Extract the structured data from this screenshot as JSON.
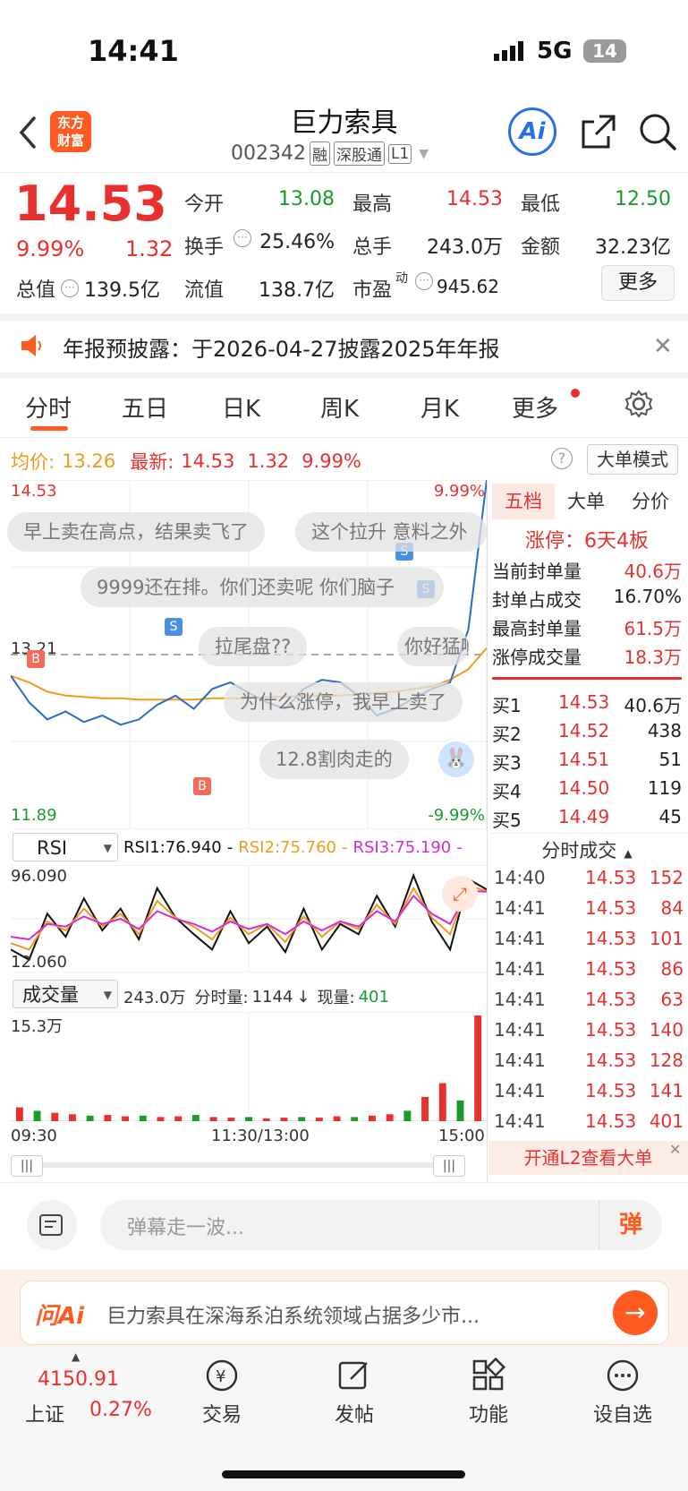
{
  "status_bar": {
    "time": "14:41",
    "network": "5G",
    "battery": "14"
  },
  "header": {
    "title": "巨力索具",
    "code": "002342",
    "tags": [
      "融",
      "深股通",
      "L1"
    ],
    "logo_line1": "东方",
    "logo_line2": "财富",
    "ai_label": "Ai"
  },
  "quote": {
    "price": "14.53",
    "change_pct": "9.99%",
    "change_amt": "1.32",
    "total_mv_label": "总值",
    "total_mv": "139.5亿",
    "fields": [
      {
        "label": "今开",
        "value": "13.08",
        "color": "#1a9c2c"
      },
      {
        "label": "最高",
        "value": "14.53",
        "color": "#e8312f"
      },
      {
        "label": "最低",
        "value": "12.50",
        "color": "#1a9c2c"
      },
      {
        "label": "换手",
        "value": "25.46%",
        "color": "#222222"
      },
      {
        "label": "总手",
        "value": "243.0万",
        "color": "#222222"
      },
      {
        "label": "金额",
        "value": "32.23亿",
        "color": "#222222"
      },
      {
        "label": "流值",
        "value": "138.7亿",
        "color": "#222222"
      },
      {
        "label": "市盈",
        "value": "945.62",
        "color": "#222222",
        "sup": "动"
      }
    ],
    "more_button": "更多"
  },
  "announcement": {
    "text": "年报预披露：于2026-04-27披露2025年年报"
  },
  "tabs": [
    "分时",
    "五日",
    "日K",
    "周K",
    "月K",
    "更多"
  ],
  "active_tab": "分时",
  "chart_header": {
    "avg_label": "均价:",
    "avg_value": "13.26",
    "latest_label": "最新:",
    "latest_value": "14.53",
    "change_amt": "1.32",
    "change_pct": "9.99%",
    "big_order_button": "大单模式"
  },
  "chart_labels": {
    "price_high": "14.53",
    "pct_high": "9.99%",
    "prev_close": "13.21",
    "price_low": "11.89",
    "pct_low": "-9.99%",
    "time_start": "09:30",
    "time_mid": "11:30/13:00",
    "time_end": "15:00",
    "trade_markers": [
      "B",
      "S",
      "B",
      "S",
      "S"
    ]
  },
  "chart_data": [
    {
      "type": "line",
      "title": "分时",
      "x_labels": [
        "09:30",
        "11:30/13:00",
        "15:00"
      ],
      "ylim": [
        11.89,
        14.53
      ],
      "reference_line": 13.21,
      "series": [
        {
          "name": "均价",
          "color": "#f09a1c",
          "values": [
            13.05,
            13.0,
            12.93,
            12.9,
            12.89,
            12.88,
            12.88,
            12.87,
            12.87,
            12.87,
            12.87,
            12.88,
            12.88,
            12.88,
            12.89,
            12.89,
            12.9,
            12.9,
            12.9,
            12.91,
            12.92,
            12.93,
            12.95,
            12.97,
            13.02,
            13.1,
            13.26
          ]
        },
        {
          "name": "最新",
          "color": "#2b6cc4",
          "values": [
            13.05,
            12.85,
            12.72,
            12.78,
            12.7,
            12.75,
            12.68,
            12.72,
            12.83,
            12.9,
            12.8,
            12.95,
            13.0,
            12.92,
            12.85,
            12.8,
            12.95,
            13.02,
            13.0,
            12.9,
            12.75,
            12.8,
            12.88,
            12.95,
            13.0,
            13.4,
            14.53
          ]
        }
      ]
    },
    {
      "type": "line",
      "title": "RSI",
      "ylim": [
        12.06,
        96.09
      ],
      "series": [
        {
          "name": "RSI1",
          "color": "#111111",
          "values": [
            30,
            22,
            58,
            40,
            70,
            45,
            62,
            38,
            78,
            55,
            42,
            30,
            60,
            35,
            48,
            28,
            62,
            30,
            50,
            42,
            72,
            48,
            88,
            52,
            30,
            85,
            76.94
          ]
        },
        {
          "name": "RSI2",
          "color": "#f09a1c",
          "values": [
            35,
            30,
            52,
            45,
            62,
            48,
            58,
            42,
            68,
            55,
            48,
            38,
            55,
            42,
            50,
            36,
            56,
            40,
            52,
            46,
            65,
            50,
            78,
            55,
            42,
            80,
            75.76
          ]
        },
        {
          "name": "RSI3",
          "color": "#d62ad6",
          "values": [
            40,
            38,
            50,
            48,
            56,
            50,
            54,
            46,
            60,
            54,
            50,
            44,
            52,
            46,
            50,
            42,
            52,
            45,
            52,
            48,
            60,
            52,
            72,
            58,
            50,
            76,
            75.19
          ]
        }
      ]
    },
    {
      "type": "bar",
      "title": "成交量",
      "ylim": [
        0,
        15.3
      ],
      "values": [
        2.0,
        1.5,
        1.2,
        1.0,
        0.8,
        0.9,
        0.7,
        0.8,
        0.6,
        0.7,
        0.9,
        0.6,
        0.5,
        0.6,
        0.4,
        0.5,
        0.6,
        0.5,
        0.7,
        0.6,
        0.8,
        1.0,
        1.5,
        3.5,
        5.5,
        3.0,
        15.3
      ]
    }
  ],
  "rsi": {
    "selector": "RSI",
    "rsi1": "RSI1:76.940",
    "rsi2": "RSI2:75.760",
    "rsi3": "RSI3:75.190",
    "max": "96.090",
    "min": "12.060"
  },
  "volume": {
    "selector": "成交量",
    "total": "243.0万",
    "period_label": "分时量:",
    "period_value": "1144",
    "now_label": "现量:",
    "now_value": "401",
    "max": "15.3万"
  },
  "danmaku": [
    "早上卖在高点，结果卖飞了",
    "这个拉升 意料之外",
    "9999还在排。你们还卖呢 你们脑子",
    "拉尾盘??",
    "你好猛啊",
    "为什么涨停，我早上卖了",
    "12.8割肉走的"
  ],
  "side_tabs": [
    "五档",
    "大单",
    "分价"
  ],
  "side_active": "五档",
  "limit_info": {
    "title": "涨停：6天4板",
    "rows": [
      {
        "label": "当前封单量",
        "value": "40.6万"
      },
      {
        "label": "封单占成交",
        "value": "16.70%"
      },
      {
        "label": "最高封单量",
        "value": "61.5万"
      },
      {
        "label": "涨停成交量",
        "value": "18.3万"
      }
    ]
  },
  "order_book": [
    {
      "label": "买1",
      "price": "14.53",
      "vol": "40.6万"
    },
    {
      "label": "买2",
      "price": "14.52",
      "vol": "438"
    },
    {
      "label": "买3",
      "price": "14.51",
      "vol": "51"
    },
    {
      "label": "买4",
      "price": "14.50",
      "vol": "119"
    },
    {
      "label": "买5",
      "price": "14.49",
      "vol": "45"
    }
  ],
  "trades_title": "分时成交",
  "trades": [
    {
      "time": "14:40",
      "price": "14.53",
      "vol": "152"
    },
    {
      "time": "14:41",
      "price": "14.53",
      "vol": "84"
    },
    {
      "time": "14:41",
      "price": "14.53",
      "vol": "101"
    },
    {
      "time": "14:41",
      "price": "14.53",
      "vol": "86"
    },
    {
      "time": "14:41",
      "price": "14.53",
      "vol": "63"
    },
    {
      "time": "14:41",
      "price": "14.53",
      "vol": "140"
    },
    {
      "time": "14:41",
      "price": "14.53",
      "vol": "128"
    },
    {
      "time": "14:41",
      "price": "14.53",
      "vol": "141"
    },
    {
      "time": "14:41",
      "price": "14.53",
      "vol": "401"
    }
  ],
  "l2_banner": "开通L2查看大单",
  "danmaku_input": {
    "placeholder": "弹幕走一波...",
    "send": "弹"
  },
  "ai_bar": {
    "brand": "问Ai",
    "text": "巨力索具在深海系泊系统领域占据多少市..."
  },
  "bottom_nav": {
    "index_value": "4150.91",
    "index_name": "上证",
    "index_pct": "0.27%",
    "items": [
      "交易",
      "发帖",
      "功能",
      "设自选"
    ]
  }
}
